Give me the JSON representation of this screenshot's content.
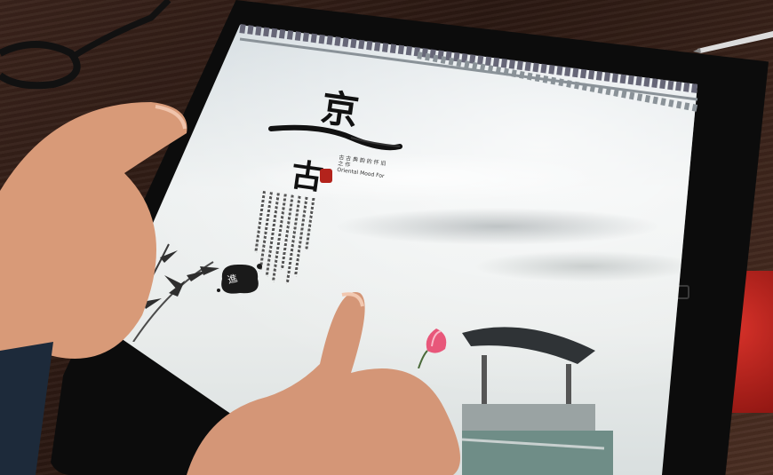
{
  "scene": {
    "screen_title_chars": [
      "京",
      "古"
    ],
    "subtitle_lines": [
      "古 古 典 韵 的 怀 旧 之 作",
      "Oriental Mood For"
    ],
    "ink_button_label": "進",
    "colors": {
      "desk": "#2a1812",
      "tablet_bezel": "#0c0c0c",
      "screen_sky": "#e9eceb",
      "seal_red": "#b3231c",
      "lotus_pink": "#e8577a",
      "skin": "#d89a78",
      "red_object": "#c5281f"
    },
    "icons": [
      "reading-glasses-icon",
      "pen-icon",
      "bamboo-icon",
      "lotus-icon",
      "pavilion-icon",
      "seal-icon"
    ]
  }
}
